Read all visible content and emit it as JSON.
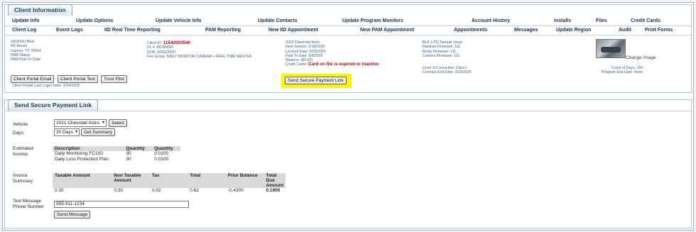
{
  "client_info": {
    "tab_label": "Client Information",
    "nav_row1": [
      "Update Info",
      "Update Options",
      "Update Vehicle Info",
      "Update Contacts",
      "Update Program Monitors",
      "Account History",
      "Installs",
      "Files",
      "Credit Cards"
    ],
    "nav_row2": [
      "Client Log",
      "Event Logs",
      "IID Real Time Reporting",
      "PAM Reporting",
      "New IID Appointment",
      "New PAM Appointment",
      "Appointments",
      "Messages",
      "Update Region",
      "Audit",
      "Print Forms"
    ],
    "address": [
      "SIDDIHU BEH",
      "My House",
      "Lopeno, TX 78564",
      "PAM Status:",
      "PAM Paid To Date:"
    ],
    "client_id_label": "Client ID:",
    "client_id": "11542003540",
    "dl": "DL #: 89789689",
    "dob": "DOB: 02/02/2000",
    "fee_group": "Fee Group: DAILY MONITOR CAMERA + REAL TIME MASTER",
    "vehicle": "2023 Chevrolet Astro",
    "next_service": "Next Service: 2/18/2025",
    "lockout_date": "Lockout Date: 2/25/2025",
    "paid_to_date": "Paid To Date: 5/8/2025",
    "balance": "Balance: ($0.43)",
    "credit_cards_label": "Credit Cards:",
    "credit_cards_status": "Card on file is expired or inactive",
    "device": "BLE 1250 Sample Head",
    "handset_fw": "Handset Firmware: 111",
    "relay_fw": "Relay Firmware: 111",
    "camera_fw": "Camera Firmware: 111",
    "level_conviction": "Level of Conviction: Class I",
    "contract_end": "Contract End Date: 3/10/2025",
    "count_days": "Count of Days: 150",
    "program_end": "Program End Date: None",
    "change_image": "Change Image",
    "buttons": {
      "portal_email": "Client Portal Email",
      "portal_text": "Client Portal Text",
      "trust_pilot": "Trust Pilot",
      "send_secure": "Send Secure Payment Link"
    },
    "last_login": "Client Portal Last Login Date: 2/24/2025"
  },
  "payment_link": {
    "tab_label": "Send Secure Payment Link",
    "vehicle_label": "Vehicle:",
    "vehicle_value": "2021 Chevrolet Astro",
    "select_button": "Select",
    "days_label": "Days:",
    "days_value": "30 Days",
    "get_summary_button": "Get Summary",
    "estimated_label_1": "Estimated",
    "estimated_label_2": "Invoice:",
    "estimate_headers": [
      "Description",
      "Quantity",
      "Quantity"
    ],
    "estimate_rows": [
      [
        "Daily Monitoring FC100",
        "30",
        "0.0100"
      ],
      [
        "Daily Loss Protection Plan",
        "30",
        "0.0100"
      ]
    ],
    "invoice_label_1": "Invoice",
    "invoice_label_2": "Summary:",
    "summary_headers": [
      "Taxable Amount",
      "Non Taxable Amount",
      "Tax",
      "Total",
      "Prior Balance",
      "Total Due Amount"
    ],
    "summary_values": [
      "0.30",
      "0.30",
      "0.02",
      "0.62",
      "-0.4300",
      "0.1900"
    ],
    "text_label_1": "Text Message",
    "text_label_2": "Phone Number",
    "phone_value": "555-911-1234",
    "send_message_button": "Send Message"
  }
}
